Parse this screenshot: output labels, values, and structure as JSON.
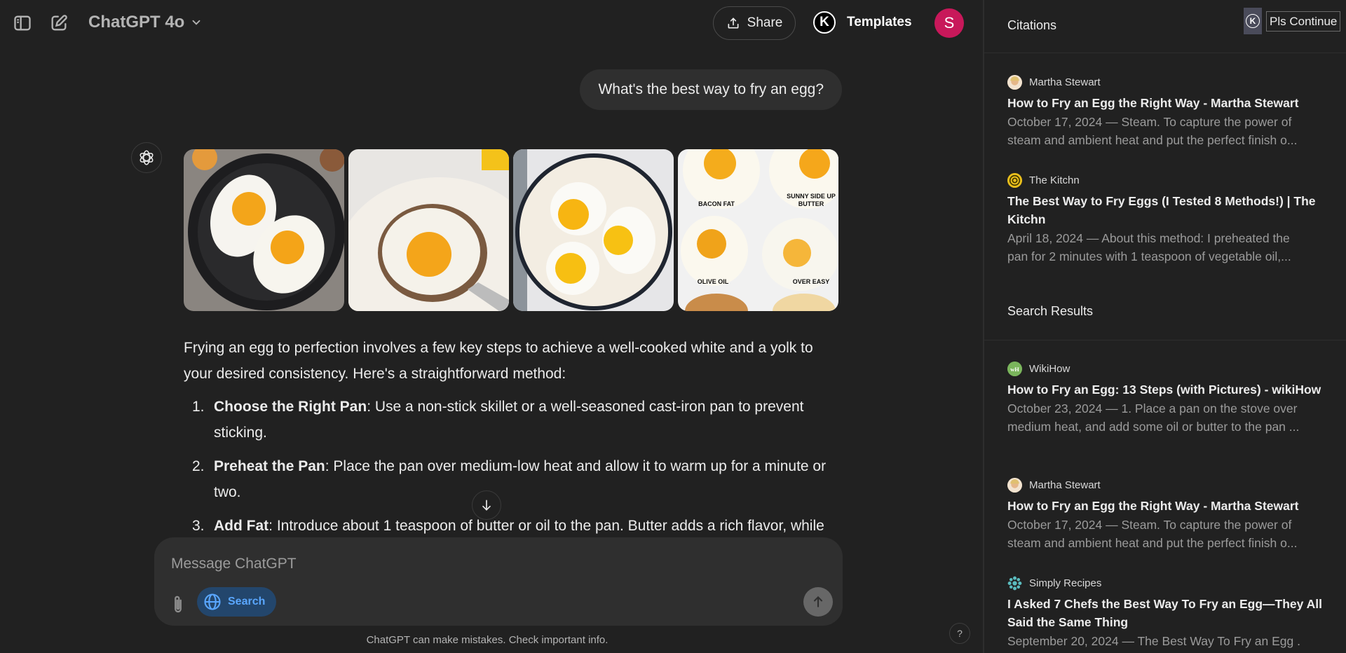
{
  "topbar": {
    "sidebar_toggle_icon": "sidebar-toggle-icon",
    "new_chat_icon": "new-chat-icon",
    "model_label": "ChatGPT 4o",
    "share_label": "Share",
    "templates_badge": "K",
    "templates_label": "Templates",
    "avatar_initial": "S",
    "avatar_color": "#c8185a"
  },
  "conversation": {
    "user_message": "What's the best way to fry an egg?",
    "images": [
      {
        "alt": "Two fried eggs in a cast-iron skillet"
      },
      {
        "alt": "Fried egg lifted with a spatula"
      },
      {
        "alt": "Three fried eggs in a white pan"
      },
      {
        "alt": "Fried eggs comparison",
        "labels": [
          "BACON FAT",
          "SUNNY SIDE UP BUTTER",
          "OLIVE OIL",
          "OVER EASY"
        ]
      }
    ],
    "intro": "Frying an egg to perfection involves a few key steps to achieve a well-cooked white and a yolk to your desired consistency. Here's a straightforward method:",
    "steps": [
      {
        "num": "1.",
        "title": "Choose the Right Pan",
        "text": ": Use a non-stick skillet or a well-seasoned cast-iron pan to prevent sticking."
      },
      {
        "num": "2.",
        "title": "Preheat the Pan",
        "text": ": Place the pan over medium-low heat and allow it to warm up for a minute or two."
      },
      {
        "num": "3.",
        "title": "Add Fat",
        "text": ": Introduce about 1 teaspoon of butter or oil to the pan. Butter adds a rich flavor, while"
      }
    ]
  },
  "composer": {
    "placeholder": "Message ChatGPT",
    "search_label": "Search",
    "accent": "#5aa7ff"
  },
  "footer": {
    "disclaimer": "ChatGPT can make mistakes. Check important info.",
    "help": "?"
  },
  "panel": {
    "title": "Citations",
    "ext_badge": "K",
    "ext_button": "Pls Continue",
    "citations": [
      {
        "source": "Martha Stewart",
        "title": "How to Fry an Egg the Right Way - Martha Stewart",
        "snippet": "October 17, 2024 — Steam. To capture the power of\nsteam and ambient heat and put the perfect finish o..."
      },
      {
        "source": "The Kitchn",
        "title": "The Best Way to Fry Eggs (I Tested 8 Methods!) | The Kitchn",
        "snippet": "April 18, 2024 — About this method: I preheated the\npan for 2 minutes with 1 teaspoon of vegetable oil,..."
      }
    ],
    "search_results_title": "Search Results",
    "search_results": [
      {
        "source": "WikiHow",
        "title": "How to Fry an Egg: 13 Steps (with Pictures) - wikiHow",
        "snippet": "October 23, 2024 — 1. Place a pan on the stove over\nmedium heat, and add some oil or butter to the pan ..."
      },
      {
        "source": "Martha Stewart",
        "title": "How to Fry an Egg the Right Way - Martha Stewart",
        "snippet": "October 17, 2024 — Steam. To capture the power of\nsteam and ambient heat and put the perfect finish o..."
      },
      {
        "source": "Simply Recipes",
        "title": "I Asked 7 Chefs the Best Way To Fry an Egg—They All Said the Same Thing",
        "snippet": "September 20, 2024 — The Best Way To Fry an Egg ."
      }
    ]
  }
}
